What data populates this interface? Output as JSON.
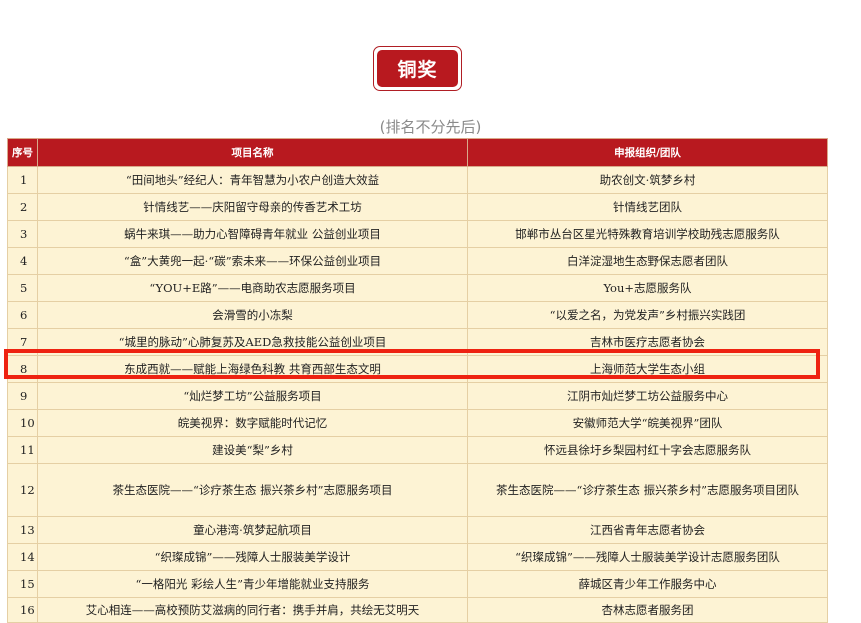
{
  "award": {
    "title": "铜奖"
  },
  "subtitle": "(排名不分先后)",
  "table": {
    "headers": [
      "序号",
      "项目名称",
      "申报组织/团队"
    ],
    "rows": [
      {
        "no": "1",
        "project": "“田间地头”经纪人：青年智慧为小农户创造大效益",
        "team": "助农创文·筑梦乡村"
      },
      {
        "no": "2",
        "project": "针情线艺——庆阳留守母亲的传香艺术工坊",
        "team": "针情线艺团队"
      },
      {
        "no": "3",
        "project": "蜗牛来琪——助力心智障碍青年就业 公益创业项目",
        "team": "邯郸市丛台区星光特殊教育培训学校助残志愿服务队"
      },
      {
        "no": "4",
        "project": "“盒”大黄兜一起·“碳”索未来——环保公益创业项目",
        "team": "白洋淀湿地生态野保志愿者团队"
      },
      {
        "no": "5",
        "project": "“YOU+E路”——电商助农志愿服务项目",
        "team": "You+志愿服务队"
      },
      {
        "no": "6",
        "project": "会滑雪的小冻梨",
        "team": "“以爱之名，为党发声”乡村振兴实践团"
      },
      {
        "no": "7",
        "project": "“城里的脉动”心肺复苏及AED急救技能公益创业项目",
        "team": "吉林市医疗志愿者协会"
      },
      {
        "no": "8",
        "project": "东成西就——赋能上海绿色科教 共育西部生态文明",
        "team": "上海师范大学生态小组"
      },
      {
        "no": "9",
        "project": "“灿烂梦工坊”公益服务项目",
        "team": "江阴市灿烂梦工坊公益服务中心"
      },
      {
        "no": "10",
        "project": "皖美视界：数字赋能时代记忆",
        "team": "安徽师范大学“皖美视界”团队"
      },
      {
        "no": "11",
        "project": "建设美“梨”乡村",
        "team": "怀远县徐圩乡梨园村红十字会志愿服务队"
      },
      {
        "no": "12",
        "project": "茶生态医院——“诊疗茶生态 振兴茶乡村”志愿服务项目",
        "team": "茶生态医院——“诊疗茶生态 振兴茶乡村”志愿服务项目团队"
      },
      {
        "no": "13",
        "project": "童心港湾·筑梦起航项目",
        "team": "江西省青年志愿者协会"
      },
      {
        "no": "14",
        "project": "“织璨成锦”——残障人士服装美学设计",
        "team": "“织璨成锦”——残障人士服装美学设计志愿服务团队"
      },
      {
        "no": "15",
        "project": "“一格阳光 彩绘人生”青少年增能就业支持服务",
        "team": "薛城区青少年工作服务中心"
      },
      {
        "no": "16",
        "project": "艾心相连——高校预防艾滋病的同行者：携手并肩，共绘无艾明天",
        "team": "杏林志愿者服务团"
      }
    ]
  },
  "colors": {
    "header": "#b8191f",
    "row": "#fdf3d4",
    "highlight": "#ee2211"
  }
}
